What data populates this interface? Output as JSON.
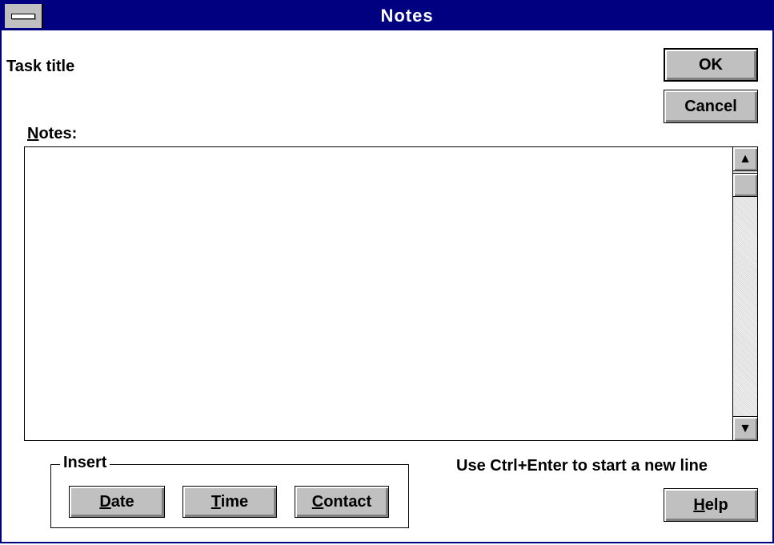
{
  "window": {
    "title": "Notes"
  },
  "task_title": "Task title",
  "notes": {
    "label_accel": "N",
    "label_rest": "otes:",
    "value": ""
  },
  "buttons": {
    "ok": "OK",
    "cancel": "Cancel",
    "help_accel": "H",
    "help_rest": "elp"
  },
  "insert_group": {
    "legend": "Insert",
    "date_accel": "D",
    "date_rest": "ate",
    "time_accel": "T",
    "time_rest": "ime",
    "contact_accel": "C",
    "contact_rest": "ontact"
  },
  "hint": "Use Ctrl+Enter to start a new line",
  "icons": {
    "system_menu": "system-menu-icon",
    "scroll_up": "▲",
    "scroll_down": "▼"
  },
  "colors": {
    "titlebar": "#000080",
    "button_face": "#c0c0c0"
  }
}
